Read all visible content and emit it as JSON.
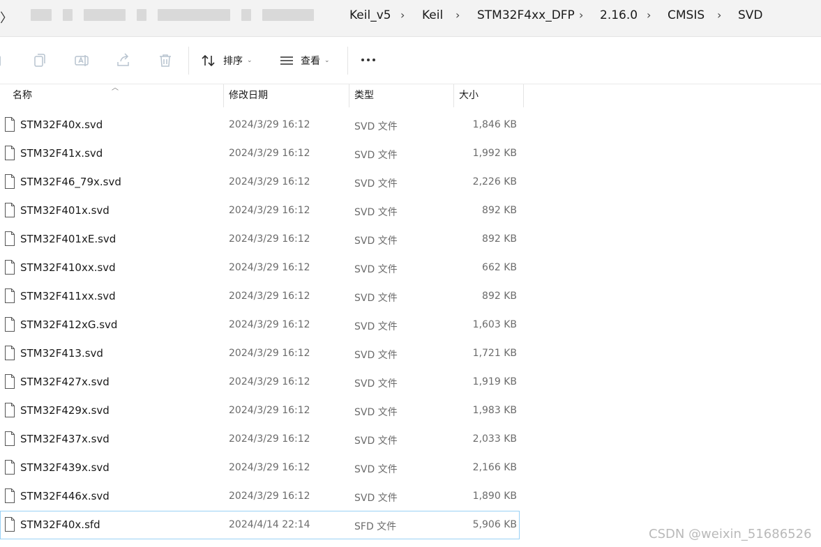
{
  "breadcrumb": {
    "items": [
      "Keil_v5",
      "Keil",
      "STM32F4xx_DFP",
      "2.16.0",
      "CMSIS",
      "SVD"
    ]
  },
  "toolbar": {
    "sort_label": "排序",
    "view_label": "查看"
  },
  "columns": {
    "name": "名称",
    "modified": "修改日期",
    "type": "类型",
    "size": "大小"
  },
  "files": [
    {
      "name": "STM32F40x.svd",
      "modified": "2024/3/29 16:12",
      "type": "SVD 文件",
      "size": "1,846 KB"
    },
    {
      "name": "STM32F41x.svd",
      "modified": "2024/3/29 16:12",
      "type": "SVD 文件",
      "size": "1,992 KB"
    },
    {
      "name": "STM32F46_79x.svd",
      "modified": "2024/3/29 16:12",
      "type": "SVD 文件",
      "size": "2,226 KB"
    },
    {
      "name": "STM32F401x.svd",
      "modified": "2024/3/29 16:12",
      "type": "SVD 文件",
      "size": "892 KB"
    },
    {
      "name": "STM32F401xE.svd",
      "modified": "2024/3/29 16:12",
      "type": "SVD 文件",
      "size": "892 KB"
    },
    {
      "name": "STM32F410xx.svd",
      "modified": "2024/3/29 16:12",
      "type": "SVD 文件",
      "size": "662 KB"
    },
    {
      "name": "STM32F411xx.svd",
      "modified": "2024/3/29 16:12",
      "type": "SVD 文件",
      "size": "892 KB"
    },
    {
      "name": "STM32F412xG.svd",
      "modified": "2024/3/29 16:12",
      "type": "SVD 文件",
      "size": "1,603 KB"
    },
    {
      "name": "STM32F413.svd",
      "modified": "2024/3/29 16:12",
      "type": "SVD 文件",
      "size": "1,721 KB"
    },
    {
      "name": "STM32F427x.svd",
      "modified": "2024/3/29 16:12",
      "type": "SVD 文件",
      "size": "1,919 KB"
    },
    {
      "name": "STM32F429x.svd",
      "modified": "2024/3/29 16:12",
      "type": "SVD 文件",
      "size": "1,983 KB"
    },
    {
      "name": "STM32F437x.svd",
      "modified": "2024/3/29 16:12",
      "type": "SVD 文件",
      "size": "2,033 KB"
    },
    {
      "name": "STM32F439x.svd",
      "modified": "2024/3/29 16:12",
      "type": "SVD 文件",
      "size": "2,166 KB"
    },
    {
      "name": "STM32F446x.svd",
      "modified": "2024/3/29 16:12",
      "type": "SVD 文件",
      "size": "1,890 KB"
    },
    {
      "name": "STM32F40x.sfd",
      "modified": "2024/4/14 22:14",
      "type": "SFD 文件",
      "size": "5,906 KB",
      "selected": true
    }
  ],
  "watermark": "CSDN @weixin_51686526"
}
